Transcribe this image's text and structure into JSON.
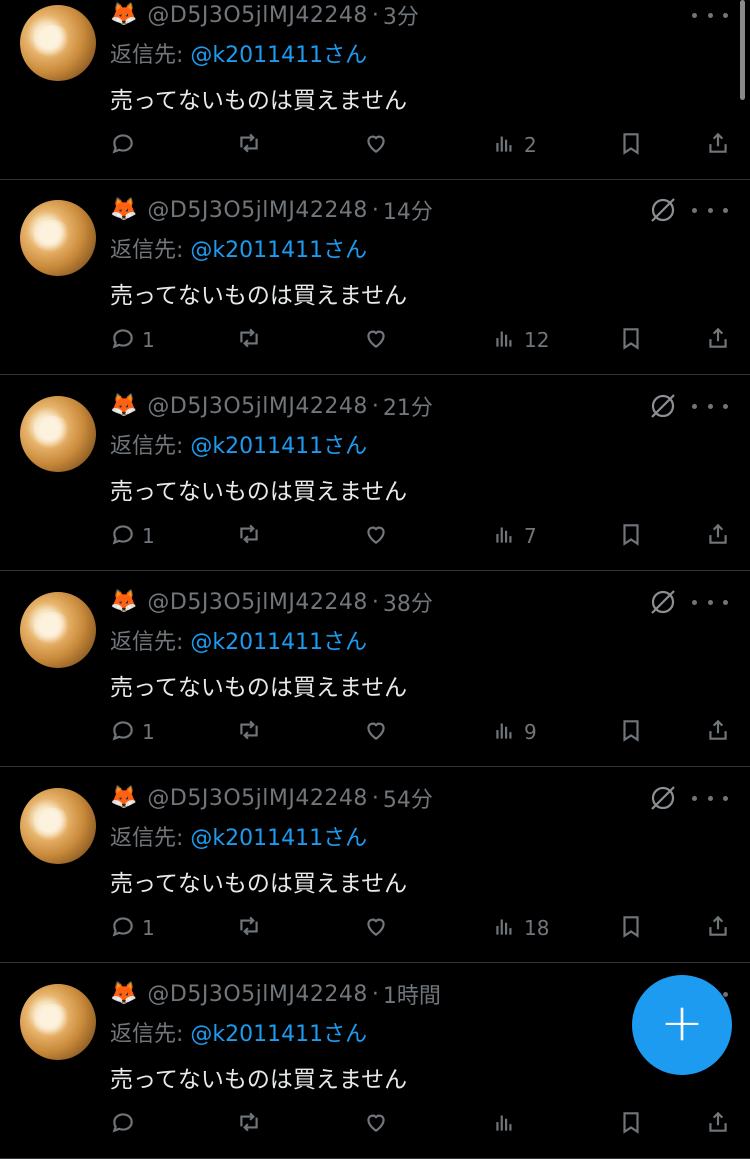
{
  "tweets": [
    {
      "emoji": "🦊",
      "handle": "@D5J3O5jlMJ42248",
      "sep": "·",
      "time": "3分",
      "reply_prefix": "返信先:",
      "reply_to": "@k2011411さん",
      "text": "売ってないものは買えません",
      "replies": "",
      "views": "2",
      "show_mute": false
    },
    {
      "emoji": "🦊",
      "handle": "@D5J3O5jlMJ42248",
      "sep": "·",
      "time": "14分",
      "reply_prefix": "返信先:",
      "reply_to": "@k2011411さん",
      "text": "売ってないものは買えません",
      "replies": "1",
      "views": "12",
      "show_mute": true
    },
    {
      "emoji": "🦊",
      "handle": "@D5J3O5jlMJ42248",
      "sep": "·",
      "time": "21分",
      "reply_prefix": "返信先:",
      "reply_to": "@k2011411さん",
      "text": "売ってないものは買えません",
      "replies": "1",
      "views": "7",
      "show_mute": true
    },
    {
      "emoji": "🦊",
      "handle": "@D5J3O5jlMJ42248",
      "sep": "·",
      "time": "38分",
      "reply_prefix": "返信先:",
      "reply_to": "@k2011411さん",
      "text": "売ってないものは買えません",
      "replies": "1",
      "views": "9",
      "show_mute": true
    },
    {
      "emoji": "🦊",
      "handle": "@D5J3O5jlMJ42248",
      "sep": "·",
      "time": "54分",
      "reply_prefix": "返信先:",
      "reply_to": "@k2011411さん",
      "text": "売ってないものは買えません",
      "replies": "1",
      "views": "18",
      "show_mute": true
    },
    {
      "emoji": "🦊",
      "handle": "@D5J3O5jlMJ42248",
      "sep": "·",
      "time": "1時間",
      "reply_prefix": "返信先:",
      "reply_to": "@k2011411さん",
      "text": "売ってないものは買えません",
      "replies": "",
      "views": "",
      "show_mute": false
    }
  ],
  "fab": {
    "label": "+"
  },
  "colors": {
    "accent": "#1d9bf0",
    "muted": "#71767b",
    "text": "#e7e9ea",
    "background": "#000000"
  }
}
